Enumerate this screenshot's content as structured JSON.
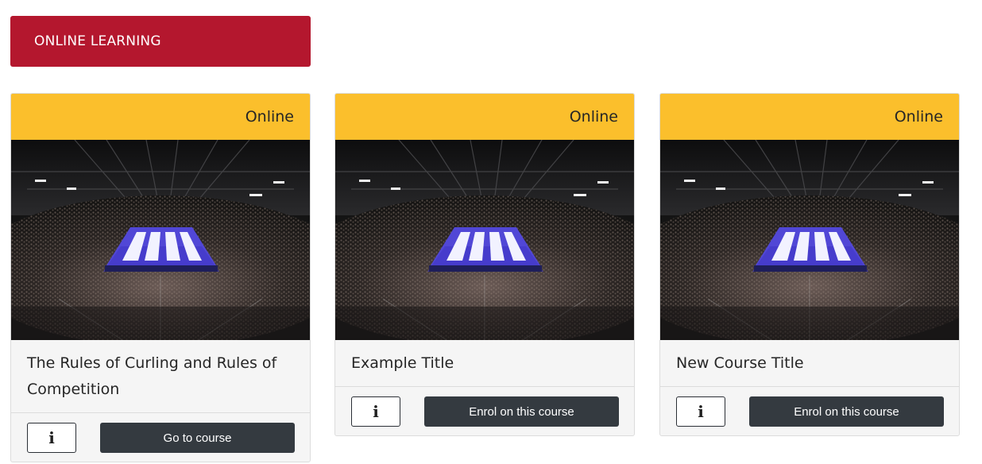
{
  "header": {
    "title": "ONLINE LEARNING"
  },
  "cards": [
    {
      "badge": "Online",
      "title": "The Rules of Curling and Rules of Competition",
      "info_icon": "info-icon",
      "action_label": "Go to course"
    },
    {
      "badge": "Online",
      "title": "Example Title",
      "info_icon": "info-icon",
      "action_label": "Enrol on this course"
    },
    {
      "badge": "Online",
      "title": "New Course Title",
      "info_icon": "info-icon",
      "action_label": "Enrol on this course"
    }
  ],
  "colors": {
    "header_bg": "#b4172e",
    "badge_bg": "#fbbf2c",
    "button_dark": "#343a40",
    "rink_ice": "#4a43d1"
  }
}
